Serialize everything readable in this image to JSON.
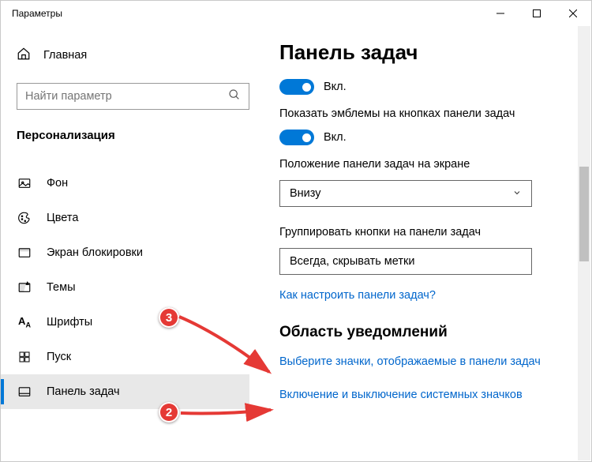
{
  "window": {
    "title": "Параметры"
  },
  "sidebar": {
    "home": "Главная",
    "search_placeholder": "Найти параметр",
    "category": "Персонализация",
    "items": [
      {
        "label": "Фон"
      },
      {
        "label": "Цвета"
      },
      {
        "label": "Экран блокировки"
      },
      {
        "label": "Темы"
      },
      {
        "label": "Шрифты"
      },
      {
        "label": "Пуск"
      },
      {
        "label": "Панель задач"
      }
    ]
  },
  "main": {
    "heading": "Панель задач",
    "toggle1_label": "Вкл.",
    "setting1": "Показать эмблемы на кнопках панели задач",
    "toggle2_label": "Вкл.",
    "setting2": "Положение панели задач на экране",
    "dropdown1": "Внизу",
    "setting3": "Группировать кнопки на панели задач",
    "dropdown2": "Всегда, скрывать метки",
    "help_link": "Как настроить панели задач?",
    "section2": "Область уведомлений",
    "link1": "Выберите значки, отображаемые в панели задач",
    "link2": "Включение и выключение системных значков"
  },
  "annotations": {
    "badge2": "2",
    "badge3": "3"
  }
}
